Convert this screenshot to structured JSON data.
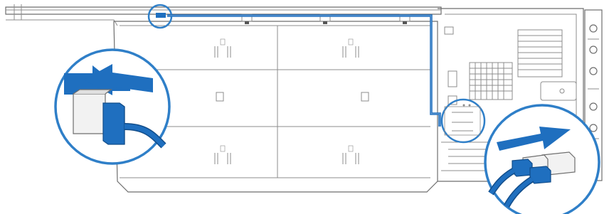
{
  "colors": {
    "cable": "#1f6fbf",
    "cable_dark": "#124d8a",
    "ring": "#2f7fc8",
    "outline": "#8c8c8c",
    "background": "#ffffff"
  },
  "callouts": [
    {
      "name": "cable-disconnect-detail",
      "action": "pull-out"
    },
    {
      "name": "cable-connect-detail",
      "action": "push-in"
    }
  ],
  "icons": [
    "left-arrow-icon",
    "right-arrow-icon",
    "connector-icon"
  ]
}
